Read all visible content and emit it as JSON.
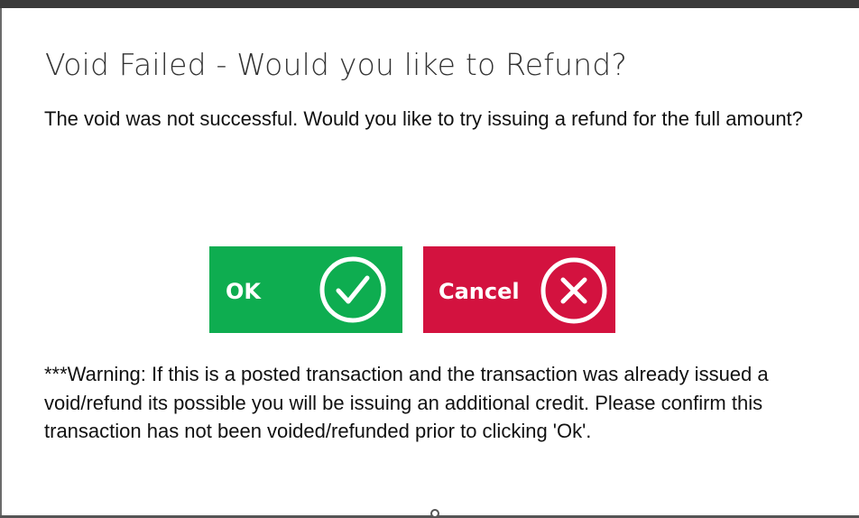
{
  "dialog": {
    "title": "Void Failed - Would you like to Refund?",
    "message": "The void was not successful. Would you like to try issuing a refund for the full amount?",
    "ok_label": "OK",
    "cancel_label": "Cancel",
    "warning": "***Warning: If this is a posted transaction and the transaction was already issued a void/refund its possible you will be issuing an additional credit. Please confirm this transaction has not been voided/refunded prior to clicking 'Ok'.",
    "icons": {
      "ok": "check-circle-icon",
      "cancel": "x-circle-icon"
    }
  },
  "colors": {
    "ok_button": "#0ead50",
    "cancel_button": "#d3123f",
    "title_text": "#333333",
    "body_text": "#111111"
  }
}
